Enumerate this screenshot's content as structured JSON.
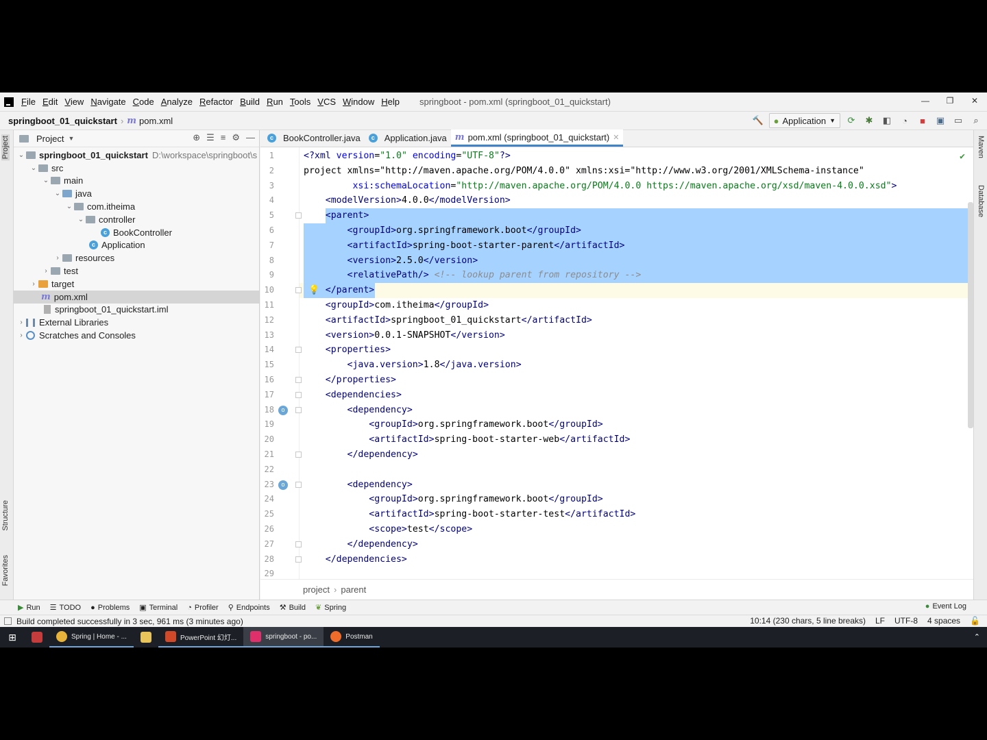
{
  "menubar": {
    "items": [
      "File",
      "Edit",
      "View",
      "Navigate",
      "Code",
      "Analyze",
      "Refactor",
      "Build",
      "Run",
      "Tools",
      "VCS",
      "Window",
      "Help"
    ],
    "window_title": "springboot - pom.xml (springboot_01_quickstart)"
  },
  "navbar": {
    "project": "springboot_01_quickstart",
    "file": "pom.xml",
    "run_config": "Application"
  },
  "project_panel": {
    "title": "Project",
    "tree": [
      {
        "label": "springboot_01_quickstart",
        "hint": "D:\\workspace\\springboot\\s"
      },
      {
        "label": "src"
      },
      {
        "label": "main"
      },
      {
        "label": "java"
      },
      {
        "label": "com.itheima"
      },
      {
        "label": "controller"
      },
      {
        "label": "BookController"
      },
      {
        "label": "Application"
      },
      {
        "label": "resources"
      },
      {
        "label": "test"
      },
      {
        "label": "target"
      },
      {
        "label": "pom.xml"
      },
      {
        "label": "springboot_01_quickstart.iml"
      },
      {
        "label": "External Libraries"
      },
      {
        "label": "Scratches and Consoles"
      }
    ]
  },
  "side_tabs": {
    "left": [
      "Project",
      "Structure",
      "Favorites"
    ],
    "right": [
      "Maven",
      "Database"
    ]
  },
  "editor": {
    "tabs": [
      "BookController.java",
      "Application.java",
      "pom.xml (springboot_01_quickstart)"
    ],
    "lines": [
      "<?xml version=\"1.0\" encoding=\"UTF-8\"?>",
      "<project xmlns=\"http://maven.apache.org/POM/4.0.0\" xmlns:xsi=\"http://www.w3.org/2001/XMLSchema-instance\"",
      "         xsi:schemaLocation=\"http://maven.apache.org/POM/4.0.0 https://maven.apache.org/xsd/maven-4.0.0.xsd\">",
      "    <modelVersion>4.0.0</modelVersion>",
      "    <parent>",
      "        <groupId>org.springframework.boot</groupId>",
      "        <artifactId>spring-boot-starter-parent</artifactId>",
      "        <version>2.5.0</version>",
      "        <relativePath/> <!-- lookup parent from repository -->",
      "    </parent>",
      "    <groupId>com.itheima</groupId>",
      "    <artifactId>springboot_01_quickstart</artifactId>",
      "    <version>0.0.1-SNAPSHOT</version>",
      "    <properties>",
      "        <java.version>1.8</java.version>",
      "    </properties>",
      "    <dependencies>",
      "        <dependency>",
      "            <groupId>org.springframework.boot</groupId>",
      "            <artifactId>spring-boot-starter-web</artifactId>",
      "        </dependency>",
      "",
      "        <dependency>",
      "            <groupId>org.springframework.boot</groupId>",
      "            <artifactId>spring-boot-starter-test</artifactId>",
      "            <scope>test</scope>",
      "        </dependency>",
      "    </dependencies>",
      ""
    ],
    "breadcrumb": [
      "project",
      "parent"
    ]
  },
  "bottom_tools": [
    "Run",
    "TODO",
    "Problems",
    "Terminal",
    "Profiler",
    "Endpoints",
    "Build",
    "Spring"
  ],
  "event_log": "Event Log",
  "statusbar": {
    "message": "Build completed successfully in 3 sec, 961 ms (3 minutes ago)",
    "position": "10:14 (230 chars, 5 line breaks)",
    "line_sep": "LF",
    "encoding": "UTF-8",
    "indent": "4 spaces"
  },
  "taskbar": {
    "items": [
      "Spring | Home - ...",
      "PowerPoint 幻灯...",
      "springboot - po...",
      "Postman"
    ]
  }
}
